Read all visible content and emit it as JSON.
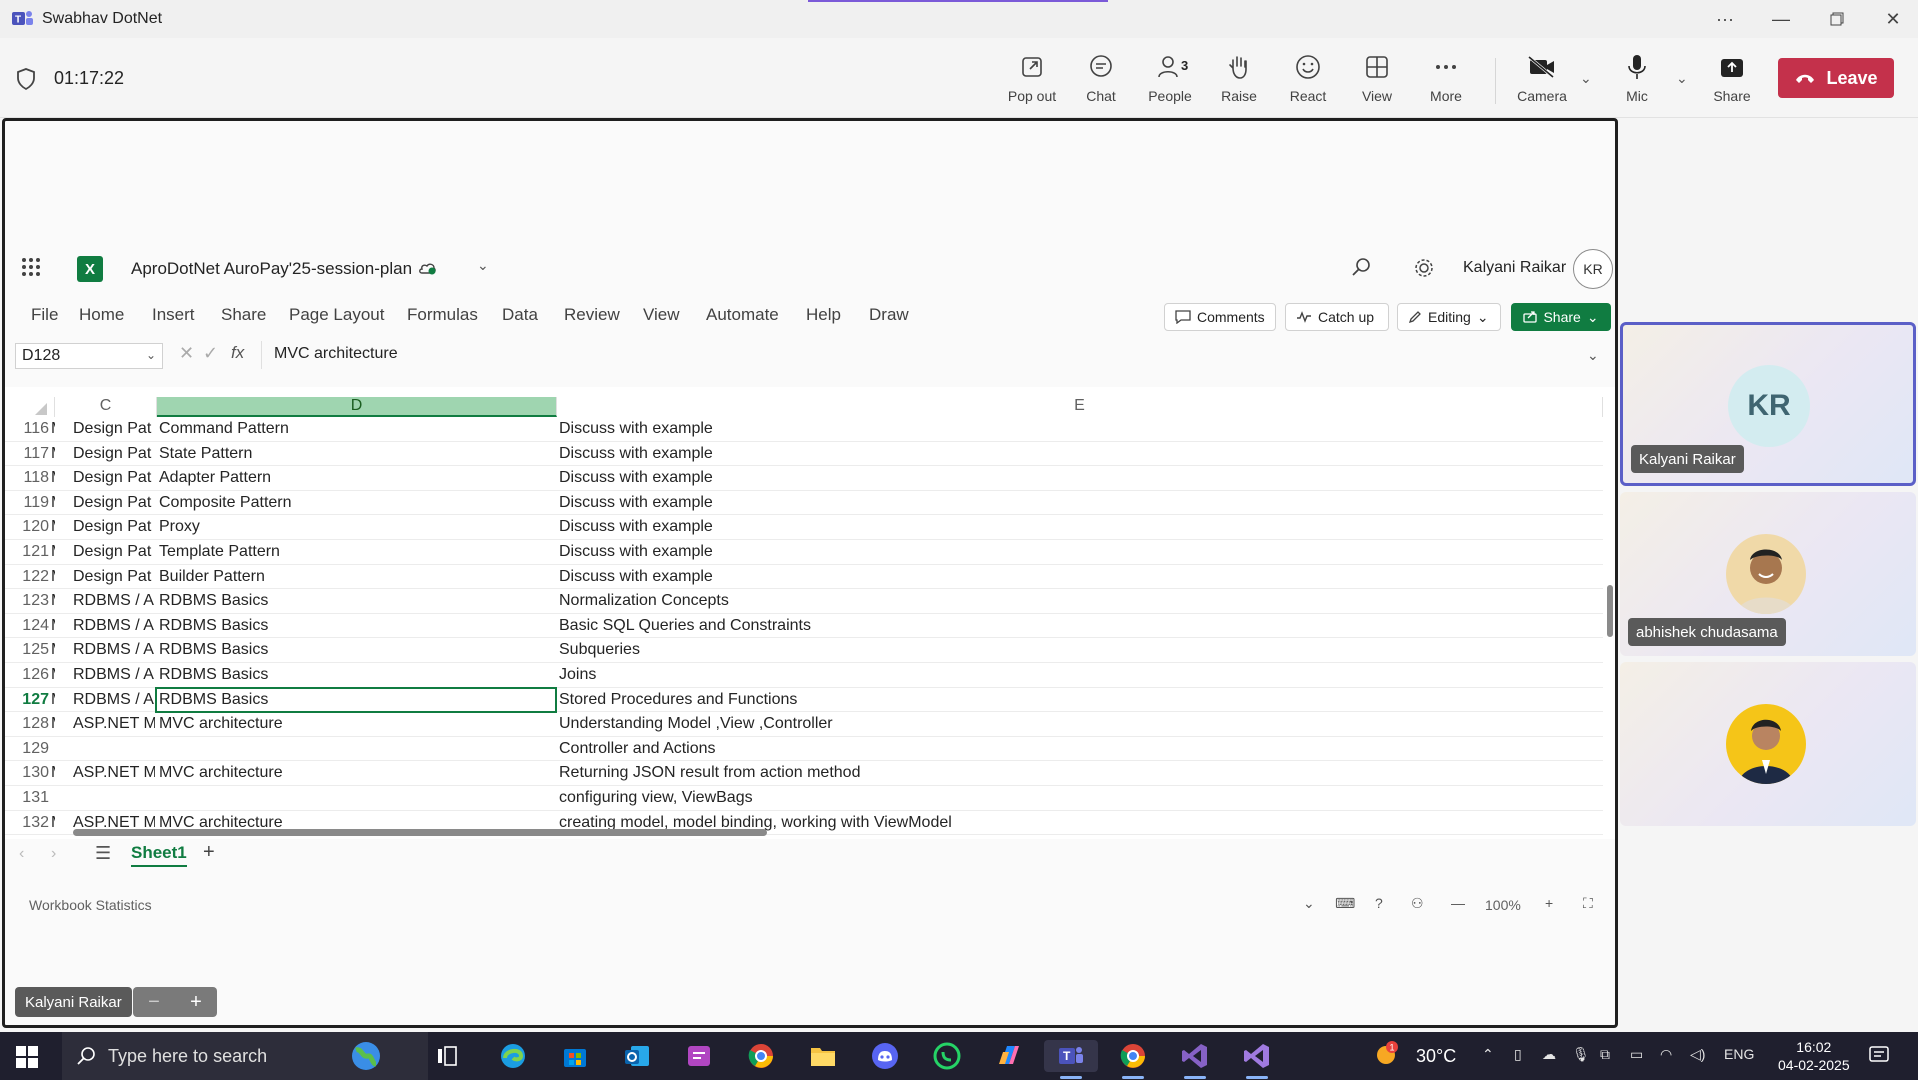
{
  "teams": {
    "window_title": "Swabhav DotNet",
    "timer": "01:17:22",
    "toolbar": [
      {
        "key": "popout",
        "label": "Pop out",
        "icon": "pop-out-icon"
      },
      {
        "key": "chat",
        "label": "Chat",
        "icon": "chat-icon"
      },
      {
        "key": "people",
        "label": "People",
        "icon": "people-icon",
        "count": "3"
      },
      {
        "key": "raise",
        "label": "Raise",
        "icon": "hand-icon"
      },
      {
        "key": "react",
        "label": "React",
        "icon": "smiley-icon"
      },
      {
        "key": "view",
        "label": "View",
        "icon": "grid-icon"
      },
      {
        "key": "more",
        "label": "More",
        "icon": "more-icon"
      },
      {
        "key": "camera",
        "label": "Camera",
        "icon": "camera-off-icon"
      },
      {
        "key": "mic",
        "label": "Mic",
        "icon": "mic-icon"
      },
      {
        "key": "share",
        "label": "Share",
        "icon": "share-tray-icon"
      }
    ],
    "leave_label": "Leave",
    "leave_color": "#c4314b",
    "accent_color": "#5b5fc7"
  },
  "excel": {
    "doc_title": "AproDotNet AuroPay'25-session-plan",
    "user_name": "Kalyani Raikar",
    "user_initials": "KR",
    "ribbon_tabs": [
      "File",
      "Home",
      "Insert",
      "Share",
      "Page Layout",
      "Formulas",
      "Data",
      "Review",
      "View",
      "Automate",
      "Help",
      "Draw"
    ],
    "comments_label": "Comments",
    "catchup_label": "Catch up",
    "editing_label": "Editing",
    "share_label": "Share",
    "name_box": "D128",
    "formula": "MVC architecture",
    "columns": {
      "c": "C",
      "d": "D",
      "e": "E"
    },
    "rows": [
      {
        "n": "116",
        "b": "M",
        "c": "Design Pat",
        "d": "Command Pattern",
        "e": "Discuss with example"
      },
      {
        "n": "117",
        "b": "M",
        "c": "Design Pat",
        "d": "State Pattern",
        "e": "Discuss with example"
      },
      {
        "n": "118",
        "b": "M",
        "c": "Design Pat",
        "d": "Adapter Pattern",
        "e": "Discuss with example"
      },
      {
        "n": "119",
        "b": "M",
        "c": "Design Pat",
        "d": "Composite Pattern",
        "e": "Discuss with example"
      },
      {
        "n": "120",
        "b": "M",
        "c": "Design Pat",
        "d": "Proxy",
        "e": "Discuss with example"
      },
      {
        "n": "121",
        "b": "M",
        "c": "Design Pat",
        "d": "Template Pattern",
        "e": "Discuss with example"
      },
      {
        "n": "122",
        "b": "M",
        "c": "Design Pat",
        "d": "Builder Pattern",
        "e": "Discuss with example"
      },
      {
        "n": "123",
        "b": "M",
        "c": "RDBMS / A",
        "d": "RDBMS Basics",
        "e": "Normalization Concepts"
      },
      {
        "n": "124",
        "b": "M",
        "c": "RDBMS / A",
        "d": "RDBMS Basics",
        "e": "Basic SQL Queries and Constraints"
      },
      {
        "n": "125",
        "b": "M",
        "c": "RDBMS / A",
        "d": "RDBMS Basics",
        "e": "Subqueries"
      },
      {
        "n": "126",
        "b": "M",
        "c": "RDBMS / A",
        "d": "RDBMS Basics",
        "e": "Joins"
      },
      {
        "n": "127",
        "b": "M",
        "c": "RDBMS / A",
        "d": "RDBMS Basics",
        "e": "Stored Procedures and Functions"
      },
      {
        "n": "128",
        "b": "M",
        "c": "ASP.NET M",
        "d": "MVC architecture",
        "e": "Understanding Model ,View ,Controller"
      },
      {
        "n": "129",
        "b": "",
        "c": "",
        "d": "",
        "e": "Controller and Actions"
      },
      {
        "n": "130",
        "b": "M",
        "c": "ASP.NET M",
        "d": "MVC architecture",
        "e": "Returning JSON result from action method"
      },
      {
        "n": "131",
        "b": "",
        "c": "",
        "d": "",
        "e": "configuring view, ViewBags"
      },
      {
        "n": "132",
        "b": "M",
        "c": "ASP.NET M",
        "d": "MVC architecture",
        "e": "creating model, model binding, working with ViewModel"
      }
    ],
    "selected_row": "127",
    "sheet_tab": "Sheet1",
    "status_left": "Workbook Statistics",
    "zoom": "100%",
    "excel_green": "#107c41"
  },
  "presenter_label": "Kalyani Raikar",
  "participants": [
    {
      "name": "Kalyani Raikar",
      "initials": "KR",
      "active": true
    },
    {
      "name": "abhishek chudasama"
    },
    {
      "name": ""
    }
  ],
  "taskbar": {
    "search_placeholder": "Type here to search",
    "temperature": "30°C",
    "weather_badge": "1",
    "language": "ENG",
    "time": "16:02",
    "date": "04-02-2025"
  }
}
